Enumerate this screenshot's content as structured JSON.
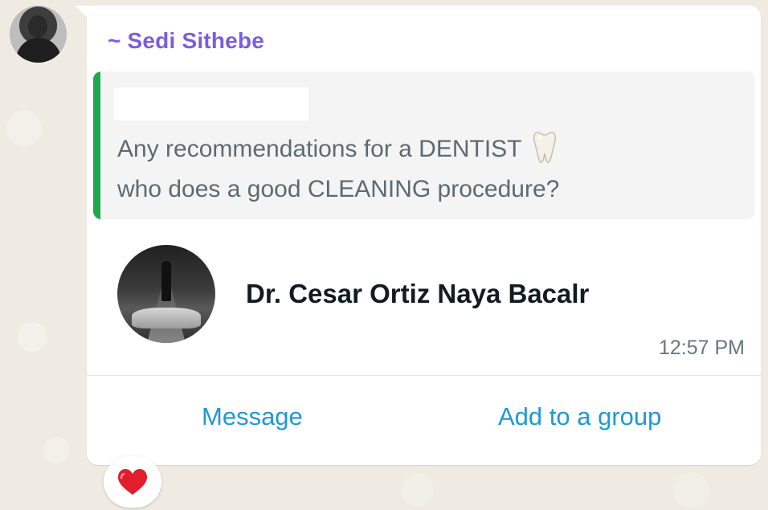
{
  "message": {
    "sender_name": "~ Sedi Sithebe",
    "quoted": {
      "line1": "Any recommendations for a DENTIST",
      "line2": "who does a good CLEANING procedure?",
      "emoji_icon": "tooth-icon"
    },
    "contact": {
      "name": "Dr. Cesar Ortiz Naya Bacalr"
    },
    "time": "12:57 PM",
    "actions": {
      "message": "Message",
      "add_to_group": "Add to a group"
    },
    "reaction_icon": "heart-icon"
  },
  "colors": {
    "sender": "#7c5ce0",
    "quote_bar": "#1ea84e",
    "action": "#1f98d6",
    "heart": "#e11d2e"
  }
}
